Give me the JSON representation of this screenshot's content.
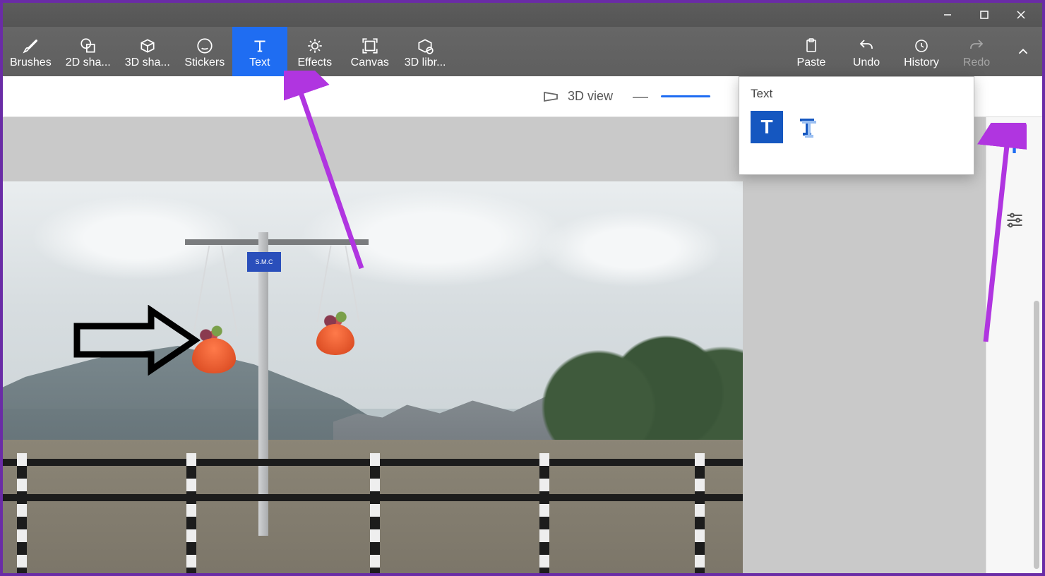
{
  "titlebar": {
    "minimize": "minimize",
    "maximize": "maximize",
    "close": "close"
  },
  "ribbon": {
    "items": [
      {
        "label": "Brushes"
      },
      {
        "label": "2D sha..."
      },
      {
        "label": "3D sha..."
      },
      {
        "label": "Stickers"
      },
      {
        "label": "Text"
      },
      {
        "label": "Effects"
      },
      {
        "label": "Canvas"
      },
      {
        "label": "3D libr..."
      }
    ],
    "right": [
      {
        "label": "Paste"
      },
      {
        "label": "Undo"
      },
      {
        "label": "History"
      },
      {
        "label": "Redo"
      }
    ]
  },
  "subbar": {
    "view3d_label": "3D view"
  },
  "flyout": {
    "title": "Text",
    "opt2d_glyph": "T"
  },
  "side": {
    "text_glyph": "T"
  },
  "photo": {
    "sign_text": "S.M.C"
  }
}
